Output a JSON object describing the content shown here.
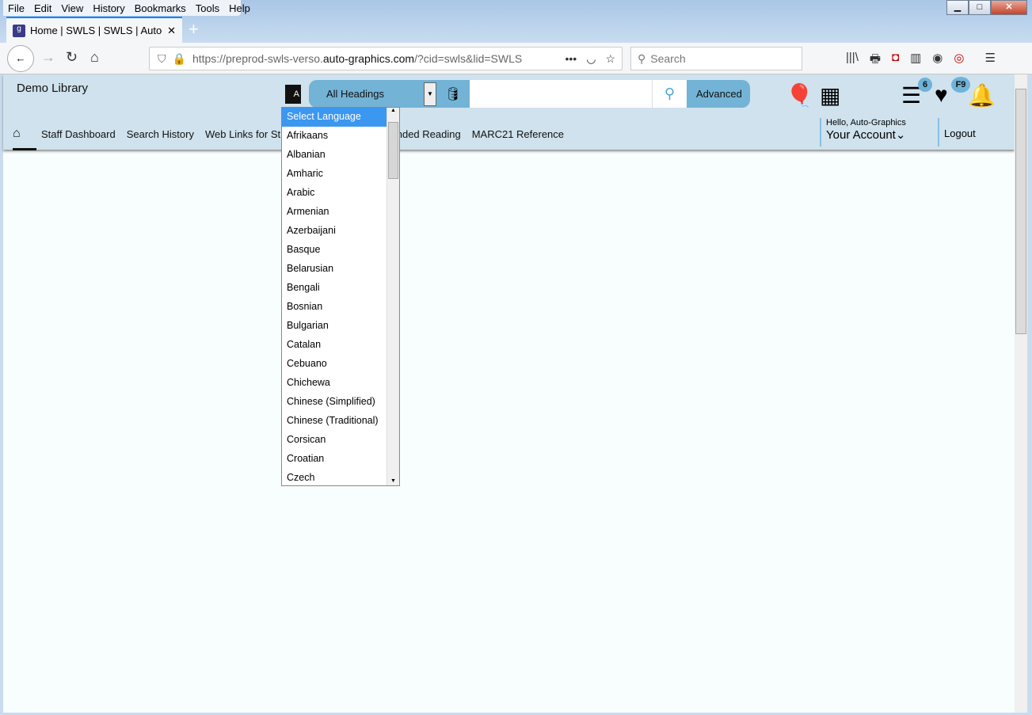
{
  "browser": {
    "menu": [
      "File",
      "Edit",
      "View",
      "History",
      "Bookmarks",
      "Tools",
      "Help"
    ],
    "tab_title": "Home | SWLS | SWLS | Auto-Graphics",
    "url_prefix": "https://preprod-swls-verso.",
    "url_domain": "auto-graphics.com",
    "url_suffix": "/?cid=swls&lid=SWLS",
    "search_placeholder": "Search"
  },
  "header": {
    "library": "Demo Library",
    "heading_select": "All Headings",
    "search_value": "",
    "advanced": "Advanced",
    "list_badge": "6",
    "fav_badge": "F9"
  },
  "nav": [
    "Staff Dashboard",
    "Search History",
    "Web Links for St",
    "commended Reading",
    "MARC21 Reference"
  ],
  "account": {
    "hello": "Hello, Auto-Graphics",
    "label": "Your Account",
    "logout": "Logout"
  },
  "language_list": {
    "selected": "Select Language",
    "items": [
      "Afrikaans",
      "Albanian",
      "Amharic",
      "Arabic",
      "Armenian",
      "Azerbaijani",
      "Basque",
      "Belarusian",
      "Bengali",
      "Bosnian",
      "Bulgarian",
      "Catalan",
      "Cebuano",
      "Chichewa",
      "Chinese (Simplified)",
      "Chinese (Traditional)",
      "Corsican",
      "Croatian",
      "Czech"
    ]
  }
}
